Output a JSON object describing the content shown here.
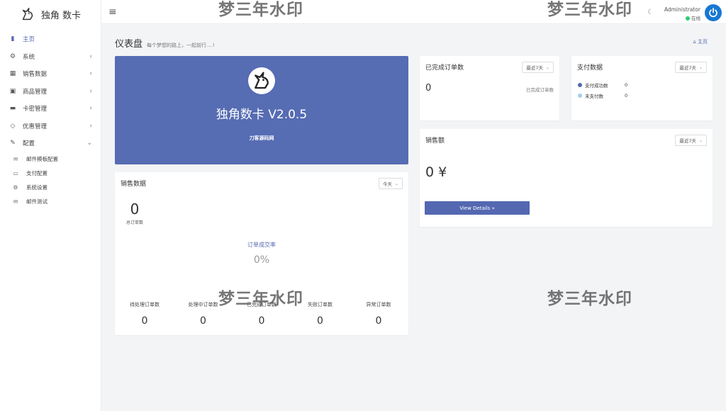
{
  "brand": {
    "name": "独角 数卡"
  },
  "sidebar": {
    "items": [
      {
        "label": "主页",
        "icon": "bar-chart-icon",
        "glyph": "▮"
      },
      {
        "label": "系统",
        "icon": "gear-icon",
        "glyph": "⚙"
      },
      {
        "label": "销售数据",
        "icon": "table-icon",
        "glyph": "▦"
      },
      {
        "label": "商品管理",
        "icon": "shopping-bag-icon",
        "glyph": "▣"
      },
      {
        "label": "卡密管理",
        "icon": "credit-card-icon",
        "glyph": "▬"
      },
      {
        "label": "优惠管理",
        "icon": "diamond-icon",
        "glyph": "◇"
      },
      {
        "label": "配置",
        "icon": "wrench-icon",
        "glyph": "✎"
      }
    ],
    "subitems": [
      {
        "label": "邮件模板配置",
        "icon": "envelope-icon",
        "glyph": "✉"
      },
      {
        "label": "支付配置",
        "icon": "visa-card-icon",
        "glyph": "▭"
      },
      {
        "label": "系统设置",
        "icon": "cogs-icon",
        "glyph": "⚙"
      },
      {
        "label": "邮件测试",
        "icon": "envelope-icon",
        "glyph": "✉"
      }
    ]
  },
  "topbar": {
    "user_name": "Administrator",
    "user_status": "在线"
  },
  "page": {
    "title": "仪表盘",
    "subtitle": "每个梦想的路上，一起前行....!",
    "breadcrumb": "主页"
  },
  "hero": {
    "title": "独角数卡 V2.0.5",
    "subtitle": "刀客源码网"
  },
  "completed_orders": {
    "title": "已完成订单数",
    "select": "最近7天",
    "value": "0",
    "label": "已完成订单数"
  },
  "payment": {
    "title": "支付数据",
    "select": "最近7天",
    "rows": [
      {
        "label": "支付成功数",
        "value": "0",
        "color": "#5468b1"
      },
      {
        "label": "未支付数",
        "value": "0",
        "color": "#9fd0f0"
      }
    ]
  },
  "sales_amount": {
    "title": "销售额",
    "select": "最近7天",
    "value": "0 ¥",
    "button": "View Details  »"
  },
  "sales_data": {
    "title": "销售数据",
    "select": "今天",
    "total_value": "0",
    "total_label": "总订单数",
    "rate_label": "订单成交率",
    "rate_value": "0%",
    "columns": [
      {
        "label": "待处理订单数",
        "value": "0"
      },
      {
        "label": "处理中订单数",
        "value": "0"
      },
      {
        "label": "已完成订单数",
        "value": "0"
      },
      {
        "label": "失败订单数",
        "value": "0"
      },
      {
        "label": "异常订单数",
        "value": "0"
      }
    ]
  },
  "watermark": "梦三年水印",
  "colors": {
    "primary": "#566cb3",
    "status_online": "#2ecc71",
    "power": "#1877d2"
  }
}
